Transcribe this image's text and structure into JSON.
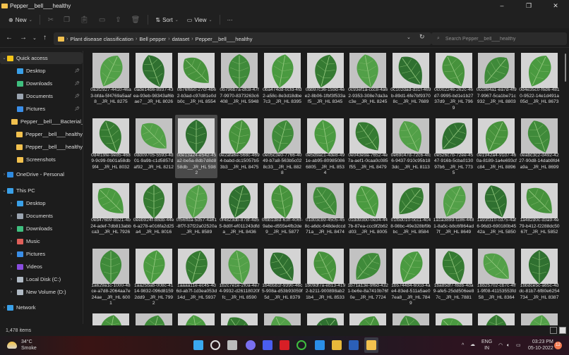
{
  "window": {
    "title": "Pepper__bell___healthy",
    "minimize": "–",
    "maximize": "❐",
    "close": "✕"
  },
  "toolbar": {
    "new_label": "New",
    "sort_label": "Sort",
    "view_label": "View",
    "more_label": "···"
  },
  "address": {
    "crumbs": [
      "Plant disease classification",
      "Bell pepper",
      "dataset",
      "Pepper__bell___healthy"
    ]
  },
  "search": {
    "placeholder": "Search Pepper__bell___healthy"
  },
  "sidebar": {
    "items": [
      {
        "label": "Quick access",
        "icon": "star-icon",
        "color": "#f5c518",
        "level": 0,
        "expand": "⌄"
      },
      {
        "label": "Desktop",
        "icon": "desktop-icon",
        "color": "#3aa0e8",
        "level": 1,
        "pin": true
      },
      {
        "label": "Downloads",
        "icon": "download-icon",
        "color": "#3fbf7f",
        "level": 1,
        "pin": true
      },
      {
        "label": "Documents",
        "icon": "documents-icon",
        "color": "#9aa4b0",
        "level": 1,
        "pin": true
      },
      {
        "label": "Pictures",
        "icon": "pictures-icon",
        "color": "#3a8ee8",
        "level": 1,
        "pin": true
      },
      {
        "label": "Pepper__bell___Bacterial_spot",
        "icon": "folder-icon",
        "color": "#f2c14e",
        "level": 1
      },
      {
        "label": "Pepper__bell___healthy",
        "icon": "folder-icon",
        "color": "#f2c14e",
        "level": 1
      },
      {
        "label": "Pepper__bell___healthy",
        "icon": "folder-icon",
        "color": "#f2c14e",
        "level": 1
      },
      {
        "label": "Screenshots",
        "icon": "folder-icon",
        "color": "#f2c14e",
        "level": 1
      },
      {
        "label": "OneDrive - Personal",
        "icon": "cloud-icon",
        "color": "#2f8be0",
        "level": 0,
        "expand": "›"
      },
      {
        "label": "This PC",
        "icon": "computer-icon",
        "color": "#3aa0e8",
        "level": 0,
        "expand": "⌄"
      },
      {
        "label": "Desktop",
        "icon": "desktop-icon",
        "color": "#3aa0e8",
        "level": 1,
        "expand": "›"
      },
      {
        "label": "Documents",
        "icon": "documents-icon",
        "color": "#9aa4b0",
        "level": 1,
        "expand": "›"
      },
      {
        "label": "Downloads",
        "icon": "download-icon",
        "color": "#3fbf7f",
        "level": 1,
        "expand": "›"
      },
      {
        "label": "Music",
        "icon": "music-icon",
        "color": "#e0605a",
        "level": 1,
        "expand": "›"
      },
      {
        "label": "Pictures",
        "icon": "pictures-icon",
        "color": "#3a8ee8",
        "level": 1,
        "expand": "›"
      },
      {
        "label": "Videos",
        "icon": "videos-icon",
        "color": "#8a4de0",
        "level": 1,
        "expand": "›"
      },
      {
        "label": "Local Disk (C:)",
        "icon": "drive-icon",
        "color": "#b0bac4",
        "level": 1,
        "expand": "›"
      },
      {
        "label": "New Volume (D:)",
        "icon": "drive-icon",
        "color": "#b0bac4",
        "level": 1,
        "expand": "›"
      },
      {
        "label": "Network",
        "icon": "network-icon",
        "color": "#3aa0e8",
        "level": 0,
        "expand": "›"
      }
    ]
  },
  "files": [
    "0a3f2927-4410-46a3-bfda-5f4769a5aaf8__JR_HL 8275",
    "0ade14b6-8937-43ea-93eb-98343af6bae7__JR_HL 8026",
    "0b76f650-27cf-4b62-b3ad-c97d81e0db0c__JR_HL 8554",
    "0b796b7a-dfc8-47f7-9970-8373263c6408__JR_HL 5948",
    "0ba474dd-0cfd-4fd2-a58c-8e3d18dbe7c3__JR_HL 8395",
    "0bb97c36-159d-4ee2-8b06-1fbf3f533af5__JR_HL 8345",
    "0c93ef1a-ccc8-4a62-9353-308e7da3ac3e__JR_HL 8245",
    "0c102dad-d31f-469b-89d1-6fe7bf93708c__JR_HL 7689",
    "0c002246-262c-46d7-9995-bd1e1b2737d9__JR_HL 7969",
    "0cc984a1-ea7d-4f97-9967-5ca1be71c932__JR_HL 8803",
    "0d4e35c0-f6d6-4810-9522-14e1d491a05d__JR_HL 8673",
    "0d4f19fe-9e85-4689-9c99-0b01a58db9f4__JR_HL 8032",
    "0dd09705-5593-4d01-9a9b-c1d5857daf92__JR_HL 8212",
    "0de13a24-e542-45a2-be5a-8db7d8d858db__JR_HL 5982",
    "0e2afa6e-568c-4694-babd-dc15057b53b3__JR_HL 8475",
    "0e05c3e0-7766-4049-b7a8-563b5c028c33__JR_HL 8828",
    "0e5d9ac1-4de8-491e-ab95-809850866805__JR_HL 8534",
    "0e043e9a-7652-4e7a-aef1-0caa0c085f55__JR_HL 8479",
    "0e69c47d-72c6-4fc6-9437-910c95b183dc__JR_HL 8113",
    "0e526c7b-72ee-4547-916b-5cba013097b6__JR_HL 7735",
    "0e1942a4-91d7-460a-8189-1a4e693cfc84__JR_HL 8896",
    "0eabc3c2-d492-4227-90d8-14dab9fd4a9a__JR_HL 8699",
    "0eb476b9-8b21-4b24-adef-7db813abbca3__JR_HL 7926",
    "0eeb924f-88db-44e6-a278-e016fa2d25a4__JR_HL 8016",
    "0f56ffda-5d57-4a61-8f7f-37f22a02520a__JR_HL 8589",
    "0f4823db-878f-4d55-8d0f-ef011243dfda__JR_HL 8436",
    "0fbb1d8d-63ff-406f-9abe-d555e4fb2de9__JR_HL 5877",
    "01d03cb9-4505-458c-a6dc-648dedccd71a__JR_HL 8474",
    "01dd93b0-0e34-447b-87ea-ccc9f2b62d03__JR_HL 8005",
    "01fbd010-0cc1-4c48-98bc-49e328bf9bbc__JR_HL 8584",
    "1a1a389d-f186-4481-8a5c-b8c6f864ad7f__JR_HL 8649",
    "1a93f310-cd75-4af6-96d3-690180b4542a__JR_HL 5850",
    "1a482d0c-d3a9-4e79-b412-f2288dc5067f__JR_HL 5852",
    "1a629a1c-1000-48ce-a7d8-2064aa7e24ae__JR_HL 6001",
    "1aa25bab-008c-4114-9832-096d81592dd9__JR_HL 7992",
    "1aaaa11e-ec45-4d6d-ab7f-1d3ea053d14d__JR_HL 5937",
    "1b2c7e1e-2f0a-4e74-9932-d26118020ffc__JR_HL 8590",
    "1b4b5b1f-9390-46c5-908a-d53b93059f5d__JR_HL 8379",
    "1b09df7a-eb13-4192-b211-900898ab21b4__JR_HL 8533",
    "1b71a13e-9f6d-4321-be6e-8a7410b76f0e__JR_HL 7724",
    "1b574484-60cd-4ae4-83ed-511a5ae07ea8__JR_HL 7849",
    "1ba85df7-f8db-4da9-afe5-25dd506ee87c__JR_HL 7881",
    "1bb25702-cb7c-4ff1-9f08-41153553fd58__JR_HL 8364",
    "1bbdce5c-a65c-4ddc-81b7-6f80e6254734__JR_HL 8387"
  ],
  "partial_row_count": 11,
  "selected_index": 13,
  "status": {
    "items": "1,478 items"
  },
  "taskbar": {
    "weather_temp": "34°C",
    "weather_desc": "Smoke",
    "apps": [
      {
        "name": "start-icon",
        "color": "#3aa8f0"
      },
      {
        "name": "search-icon",
        "color": "#dddddd"
      },
      {
        "name": "task-view-icon",
        "color": "#bbbbbb"
      },
      {
        "name": "chat-icon",
        "color": "#7a6ff0"
      },
      {
        "name": "app-icon",
        "color": "#4a5ef0"
      },
      {
        "name": "netflix-icon",
        "color": "#d81f26"
      },
      {
        "name": "green-app-icon",
        "color": "#3fbf3f"
      },
      {
        "name": "vscode-icon",
        "color": "#2a8ee8"
      },
      {
        "name": "chrome-icon",
        "color": "#e8b83a"
      },
      {
        "name": "word-icon",
        "color": "#2b5fb8"
      },
      {
        "name": "file-explorer-icon",
        "color": "#f2c14e"
      }
    ],
    "lang1": "ENG",
    "lang2": "IN",
    "time": "03:23 PM",
    "date": "05-10-2022",
    "notifications": "12"
  }
}
